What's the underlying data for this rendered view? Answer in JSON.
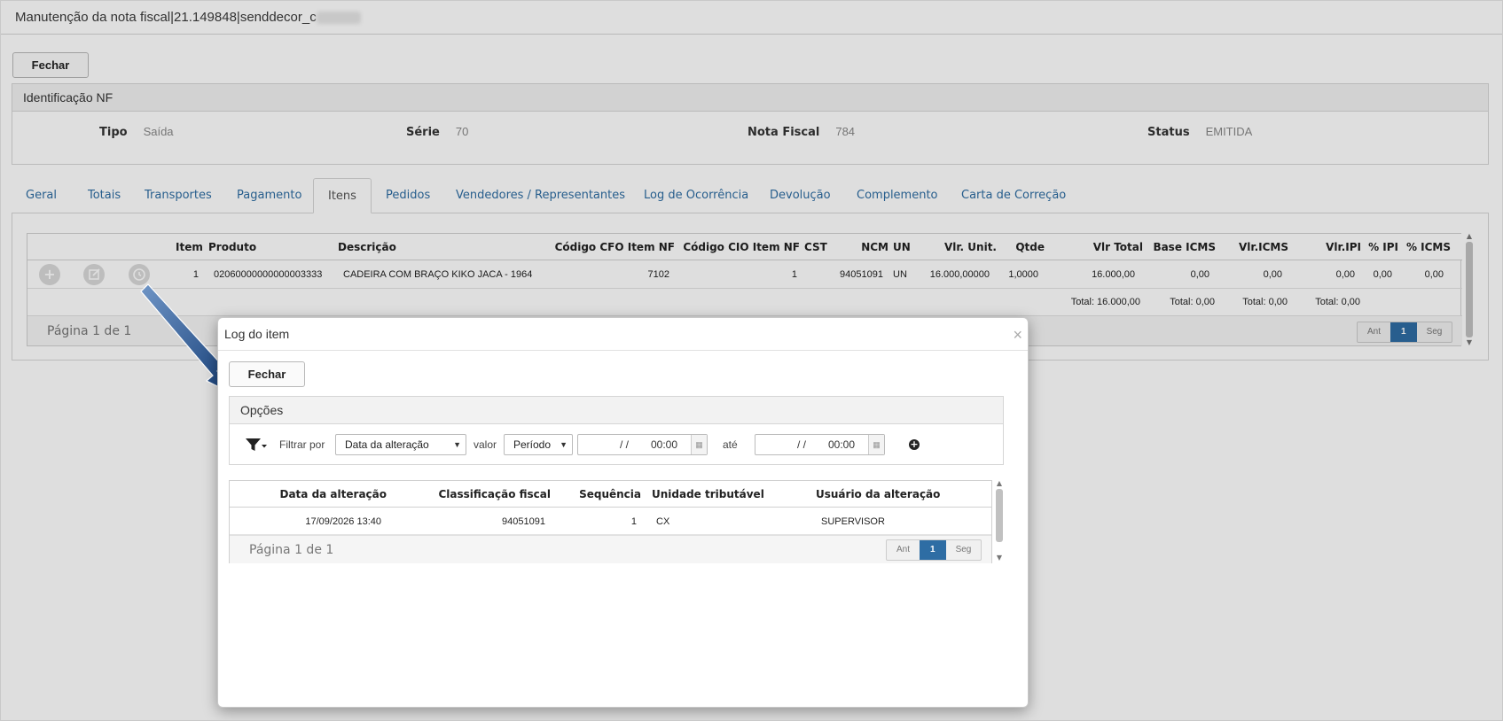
{
  "window": {
    "title": "Manutenção da nota fiscal|21.149848|senddecor_c"
  },
  "main": {
    "close_label": "Fechar"
  },
  "identificacao": {
    "heading": "Identificação NF",
    "tipo_label": "Tipo",
    "tipo_value": "Saída",
    "serie_label": "Série",
    "serie_value": "70",
    "nota_label": "Nota Fiscal",
    "nota_value": "784",
    "status_label": "Status",
    "status_value": "EMITIDA"
  },
  "tabs": [
    "Geral",
    "Totais",
    "Transportes",
    "Pagamento",
    "Itens",
    "Pedidos",
    "Vendedores / Representantes",
    "Log de Ocorrência",
    "Devolução",
    "Complemento",
    "Carta de Correção"
  ],
  "active_tab": "Itens",
  "items_grid": {
    "columns": [
      "Item",
      "Produto",
      "Descrição",
      "Código CFO Item NF",
      "Código CIO Item NF",
      "CST",
      "NCM",
      "UN",
      "Vlr. Unit.",
      "Qtde",
      "Vlr Total",
      "Base ICMS",
      "Vlr.ICMS",
      "Vlr.IPI",
      "% IPI",
      "% ICMS"
    ],
    "rows": [
      {
        "item": "1",
        "produto": "02060000000000003333",
        "descricao": "CADEIRA COM BRAÇO KIKO JACA - 1964",
        "cfo": "7102",
        "cio": "1",
        "cst": "",
        "ncm": "94051091",
        "un": "UN",
        "vlr_unit": "16.000,00000",
        "qtde": "1,0000",
        "vlr_total": "16.000,00",
        "base_icms": "0,00",
        "vlr_icms": "0,00",
        "vlr_ipi": "0,00",
        "pct_ipi": "0,00",
        "pct_icms": "0,00"
      }
    ],
    "totals": {
      "vlr_total": "Total: 16.000,00",
      "base_icms": "Total: 0,00",
      "vlr_icms": "Total: 0,00",
      "vlr_ipi": "Total: 0,00"
    },
    "page_label": "Página 1 de 1",
    "pager": {
      "prev": "Ant",
      "current": "1",
      "next": "Seg"
    }
  },
  "modal": {
    "title": "Log do item",
    "close_x": "×",
    "close_label": "Fechar",
    "options_heading": "Opções",
    "filter_label": "Filtrar por",
    "filter_field": "Data da alteração",
    "valor_label": "valor",
    "valor_mode": "Período",
    "date_from": {
      "date": "/  /",
      "time": "00:00"
    },
    "ate_label": "até",
    "date_to": {
      "date": "/  /",
      "time": "00:00"
    },
    "grid": {
      "columns": [
        "Data da alteração",
        "Classificação fiscal",
        "Sequência",
        "Unidade tributável",
        "Usuário da alteração"
      ],
      "rows": [
        {
          "data": "17/09/2026 13:40",
          "classificacao": "94051091",
          "sequencia": "1",
          "unidade": "CX",
          "usuario": "SUPERVISOR"
        }
      ],
      "page_label": "Página 1 de 1",
      "pager": {
        "prev": "Ant",
        "current": "1",
        "next": "Seg"
      }
    }
  },
  "colors": {
    "accent": "#2e6da4",
    "tab_link": "#2d6ca2",
    "arrow": "#1f4e8c"
  }
}
